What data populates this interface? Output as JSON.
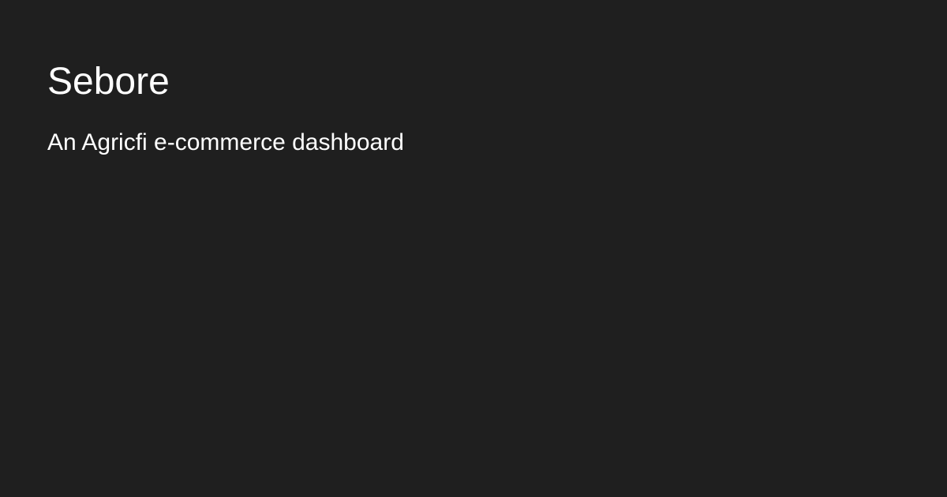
{
  "card": {
    "title": "Sebore",
    "description": "An Agricfi e-commerce dashboard"
  },
  "colors": {
    "background": "#1f1f1f",
    "text": "#ffffff"
  }
}
